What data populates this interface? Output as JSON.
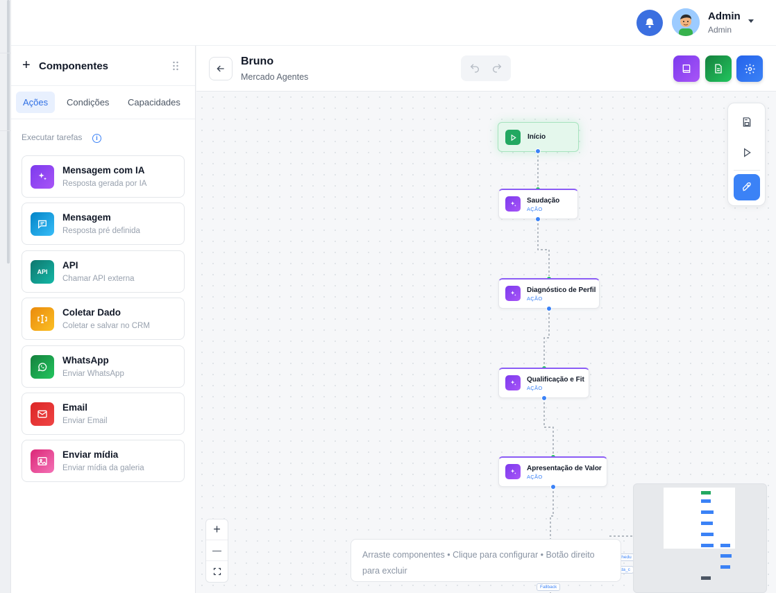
{
  "header": {
    "user_name": "Admin",
    "user_role": "Admin"
  },
  "components_panel": {
    "title": "Componentes",
    "tabs": [
      {
        "label": "Ações",
        "active": true
      },
      {
        "label": "Condições",
        "active": false
      },
      {
        "label": "Capacidades",
        "active": false
      }
    ],
    "section_label": "Executar tarefas",
    "items": [
      {
        "title": "Mensagem com IA",
        "subtitle": "Resposta gerada por IA",
        "icon": "sparkles-icon",
        "color": "#8b5cf6"
      },
      {
        "title": "Mensagem",
        "subtitle": "Resposta pré definida",
        "icon": "message-icon",
        "color": "#0ea5e9"
      },
      {
        "title": "API",
        "subtitle": "Chamar API externa",
        "icon": "api-icon",
        "icon_text": "API",
        "color": "#0d9488"
      },
      {
        "title": "Coletar Dado",
        "subtitle": "Coletar e salvar no CRM",
        "icon": "text-cursor-icon",
        "color": "#f59e0b"
      },
      {
        "title": "WhatsApp",
        "subtitle": "Enviar WhatsApp",
        "icon": "whatsapp-icon",
        "color": "#16a34a"
      },
      {
        "title": "Email",
        "subtitle": "Enviar Email",
        "icon": "mail-icon",
        "color": "#dc2626"
      },
      {
        "title": "Enviar mídia",
        "subtitle": "Enviar mídia da galeria",
        "icon": "image-icon",
        "color": "#ec4899"
      }
    ]
  },
  "editor": {
    "flow_name": "Bruno",
    "flow_subtitle": "Mercado Agentes"
  },
  "canvas": {
    "start_node": {
      "label": "Início"
    },
    "nodes": [
      {
        "label": "Saudação",
        "type": "AÇÃO"
      },
      {
        "label": "Diagnóstico de Perfil",
        "type": "AÇÃO"
      },
      {
        "label": "Qualificação e Fit",
        "type": "AÇÃO"
      },
      {
        "label": "Apresentação de Valor",
        "type": "AÇÃO"
      }
    ],
    "edge_labels": [
      "Fallback",
      "chedu",
      "ata_c"
    ],
    "hint_text": "Arraste componentes • Clique para configurar • Botão direito para excluir",
    "zoom_in": "+",
    "zoom_out": "—"
  }
}
